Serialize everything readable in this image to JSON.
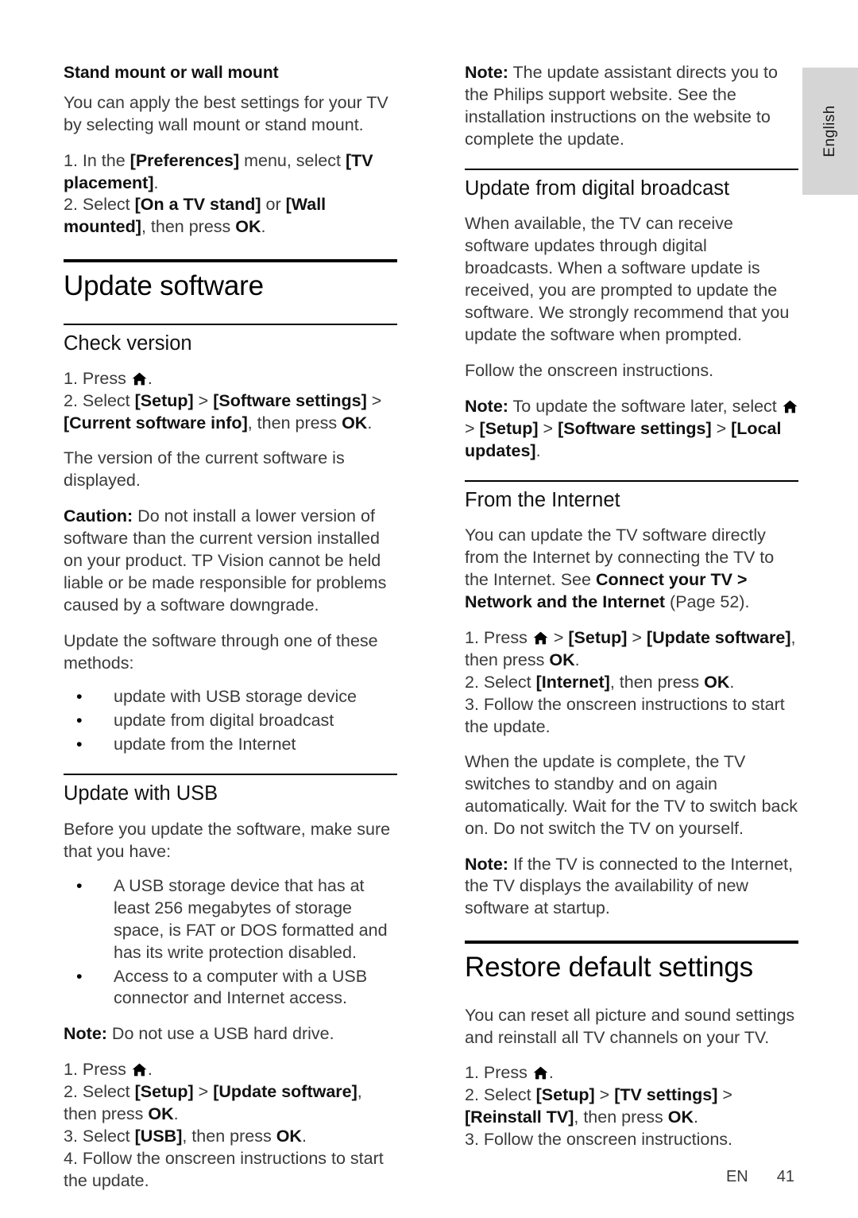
{
  "language_tab": {
    "label": "English"
  },
  "footer": {
    "language_code": "EN",
    "page_number": "41"
  },
  "icons": {
    "home": "home-icon"
  },
  "left_column": {
    "stand_mount": {
      "heading": "Stand mount or wall mount",
      "intro": "You can apply the best settings for your TV by selecting wall mount or stand mount.",
      "step1_prefix": "1. In the ",
      "step1_bold1": "[Preferences]",
      "step1_mid": " menu, select ",
      "step1_bold2": "[TV placement]",
      "step1_suffix": ".",
      "step2_prefix": "2. Select ",
      "step2_bold1": "[On a TV stand]",
      "step2_mid": " or ",
      "step2_bold2": "[Wall mounted]",
      "step2_mid2": ", then press ",
      "step2_bold3": "OK",
      "step2_suffix": "."
    },
    "update_software_title": "Update software",
    "check_version": {
      "heading": "Check version",
      "step1_prefix": "1. Press ",
      "step1_suffix": ".",
      "step2_prefix": "2. Select ",
      "step2_bold1": "[Setup]",
      "step2_gt1": " > ",
      "step2_bold2": "[Software settings]",
      "step2_gt2": " > ",
      "step2_bold3": "[Current software info]",
      "step2_mid": ", then press ",
      "step2_bold4": "OK",
      "step2_suffix": ".",
      "version_displayed": "The version of the current software is displayed.",
      "caution_label": "Caution:",
      "caution_text": " Do not install a lower version of software than the current version installed on your product. TP Vision cannot be held liable or be made responsible for problems caused by a software downgrade.",
      "methods_intro": "Update the software through one of these methods:",
      "methods": [
        "update with USB storage device",
        "update from digital broadcast",
        "update from the Internet"
      ]
    },
    "update_with_usb": {
      "heading": "Update with USB",
      "intro": "Before you update the software, make sure that you have:",
      "requirements": [
        "A USB storage device that has at least 256 megabytes of storage space, is FAT or DOS formatted and has its write protection disabled.",
        "Access to a computer with a USB connector and Internet access."
      ],
      "note_label": "Note:",
      "note_text": " Do not use a USB hard drive.",
      "step1_prefix": "1. Press ",
      "step1_suffix": ".",
      "step2_prefix": "2. Select ",
      "step2_bold1": "[Setup]",
      "step2_gt1": " > ",
      "step2_bold2": "[Update software]",
      "step2_mid": ", then press ",
      "step2_bold3": "OK",
      "step2_suffix": ".",
      "step3_prefix": "3. Select ",
      "step3_bold1": "[USB]",
      "step3_mid": ", then press ",
      "step3_bold2": "OK",
      "step3_suffix": ".",
      "step4": "4. Follow the onscreen instructions to start the update."
    }
  },
  "right_column": {
    "assistant_note": {
      "label": "Note:",
      "text": " The update assistant directs you to the Philips support website. See the installation instructions on the website to complete the update."
    },
    "digital_broadcast": {
      "heading": "Update from digital broadcast",
      "body": "When available, the TV can receive software updates through digital broadcasts. When a software update is received, you are prompted to update the software. We strongly recommend that you update the software when prompted.",
      "follow": "Follow the onscreen instructions.",
      "note_label": "Note:",
      "note_prefix": " To update the software later, select ",
      "note_gt1": " > ",
      "note_bold1": "[Setup]",
      "note_gt2": " > ",
      "note_bold2": "[Software settings]",
      "note_gt3": " > ",
      "note_bold3": "[Local updates]",
      "note_suffix": "."
    },
    "from_internet": {
      "heading": "From the Internet",
      "intro_prefix": "You can update the TV software directly from the Internet by connecting the TV to the Internet. See ",
      "intro_bold": "Connect your TV > Network and the Internet",
      "intro_suffix": " (Page 52).",
      "step1_prefix": "1. Press ",
      "step1_gt1": " > ",
      "step1_bold1": "[Setup]",
      "step1_gt2": " > ",
      "step1_bold2": "[Update software]",
      "step1_mid": ", then press ",
      "step1_bold3": "OK",
      "step1_suffix": ".",
      "step2_prefix": "2. Select ",
      "step2_bold1": "[Internet]",
      "step2_mid": ", then press ",
      "step2_bold2": "OK",
      "step2_suffix": ".",
      "step3": "3. Follow the onscreen instructions to start the update.",
      "complete_text": "When the update is complete, the TV switches to standby and on again automatically. Wait for the TV to switch back on. Do not switch the TV on yourself.",
      "note_label": "Note:",
      "note_text": " If the TV is connected to the Internet, the TV displays the availability of new software at startup."
    },
    "restore_defaults": {
      "title": "Restore default settings",
      "intro": "You can reset all picture and sound settings and reinstall all TV channels on your TV.",
      "step1_prefix": "1. Press ",
      "step1_suffix": ".",
      "step2_prefix": "2. Select ",
      "step2_bold1": "[Setup]",
      "step2_gt1": " > ",
      "step2_bold2": "[TV settings]",
      "step2_gt2": " > ",
      "step2_bold3": "[Reinstall TV]",
      "step2_mid": ", then press ",
      "step2_bold4": "OK",
      "step2_suffix": ".",
      "step3": "3. Follow the onscreen instructions."
    }
  }
}
